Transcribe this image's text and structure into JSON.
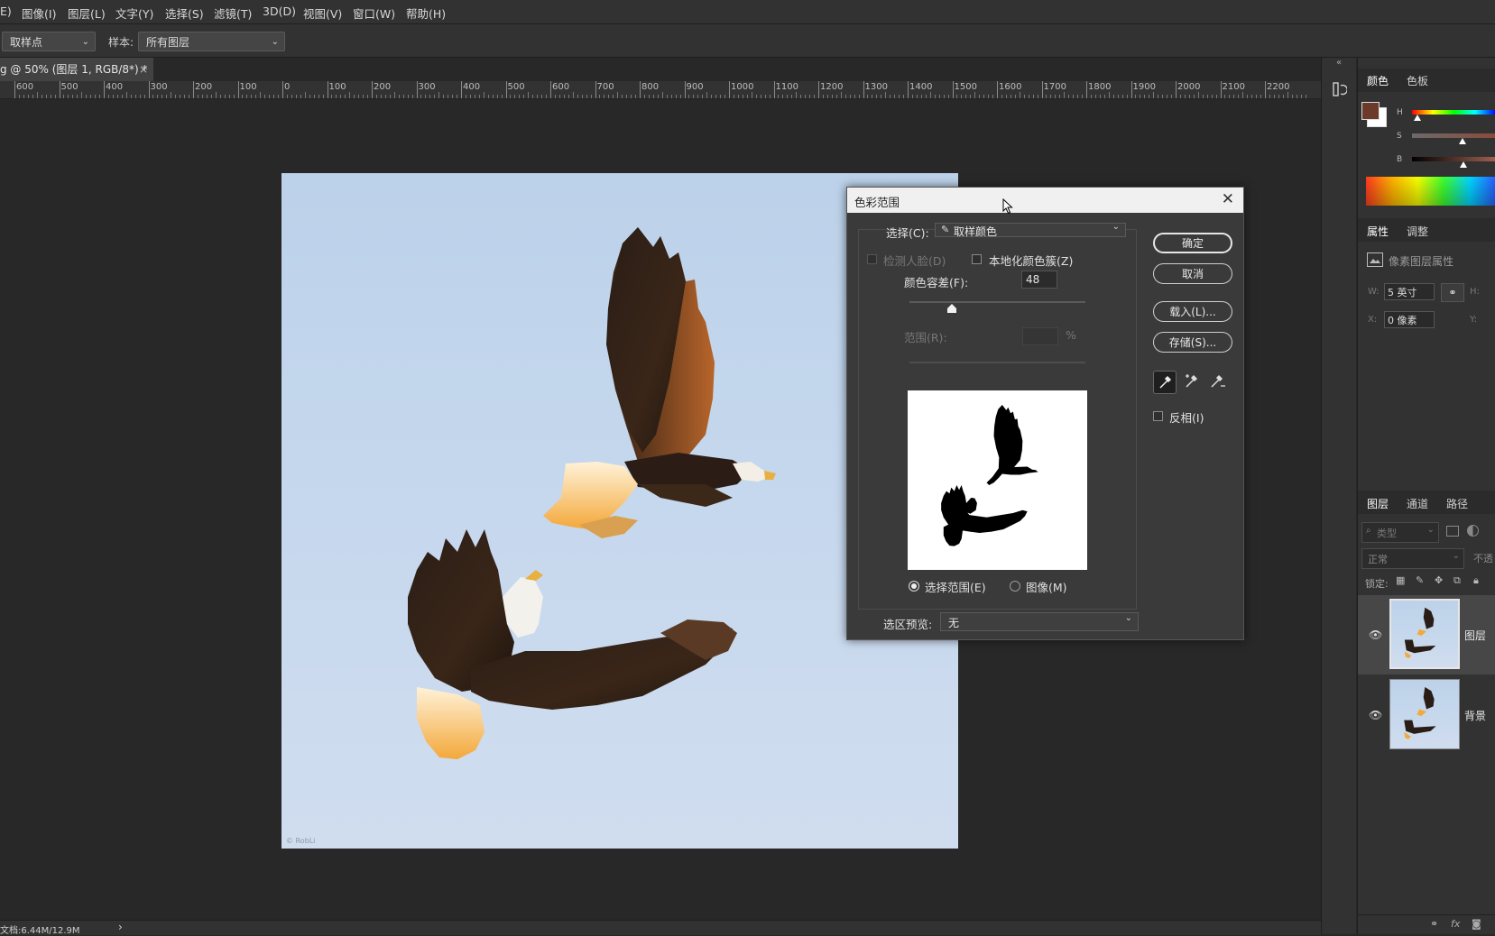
{
  "menu": {
    "items": [
      "E)",
      "图像(I)",
      "图层(L)",
      "文字(Y)",
      "选择(S)",
      "滤镜(T)",
      "3D(D)",
      "视图(V)",
      "窗口(W)",
      "帮助(H)"
    ]
  },
  "options_bar": {
    "tool_value": "取样点",
    "sample_label": "样本:",
    "sample_value": "所有图层"
  },
  "document_tab": {
    "title": "g @ 50% (图层 1, RGB/8*) *",
    "close": "×"
  },
  "ruler": {
    "labels": [
      "600",
      "500",
      "400",
      "300",
      "200",
      "100",
      "0",
      "100",
      "200",
      "300",
      "400",
      "500",
      "600",
      "700",
      "800",
      "900",
      "1000",
      "1100",
      "1200",
      "1300",
      "1400",
      "1500",
      "1600",
      "1700",
      "1800",
      "1900",
      "2000",
      "2100",
      "2200"
    ]
  },
  "canvas": {
    "watermark": "© RobLi"
  },
  "status_bar": {
    "doc_info": "文档:6.44M/12.9M",
    "arrow": "›"
  },
  "color_panel": {
    "tabs": [
      "颜色",
      "色板"
    ],
    "slider_labels": [
      "H",
      "S",
      "B"
    ],
    "foreground_color": "#6b3a2a",
    "background_color": "#ffffff"
  },
  "properties_panel": {
    "tabs": [
      "属性",
      "调整"
    ],
    "subtitle": "像素图层属性",
    "w_label": "W:",
    "w_value": "5 英寸",
    "h_label": "H:",
    "x_label": "X:",
    "x_value": "0 像素",
    "y_label": "Y:"
  },
  "layers_panel": {
    "tabs": [
      "图层",
      "通道",
      "路径"
    ],
    "filter_placeholder": "类型",
    "blend_mode": "正常",
    "opacity_label": "不透",
    "lock_label": "锁定:",
    "layers": [
      {
        "name": "图层",
        "selected": true
      },
      {
        "name": "背景",
        "selected": false
      }
    ],
    "footer_fx": "fx"
  },
  "dialog": {
    "title": "色彩范围",
    "select_label": "选择(C):",
    "select_value": "取样颜色",
    "detect_faces": "检测人脸(D)",
    "localized_clusters": "本地化颜色簇(Z)",
    "fuzziness_label": "颜色容差(F):",
    "fuzziness_value": "48",
    "fuzziness": 48,
    "range_label": "范围(R):",
    "range_unit": "%",
    "radio_selection": "选择范围(E)",
    "radio_image": "图像(M)",
    "preview_label": "选区预览:",
    "preview_value": "无",
    "buttons": {
      "ok": "确定",
      "cancel": "取消",
      "load": "载入(L)...",
      "save": "存储(S)..."
    },
    "invert_label": "反相(I)"
  }
}
